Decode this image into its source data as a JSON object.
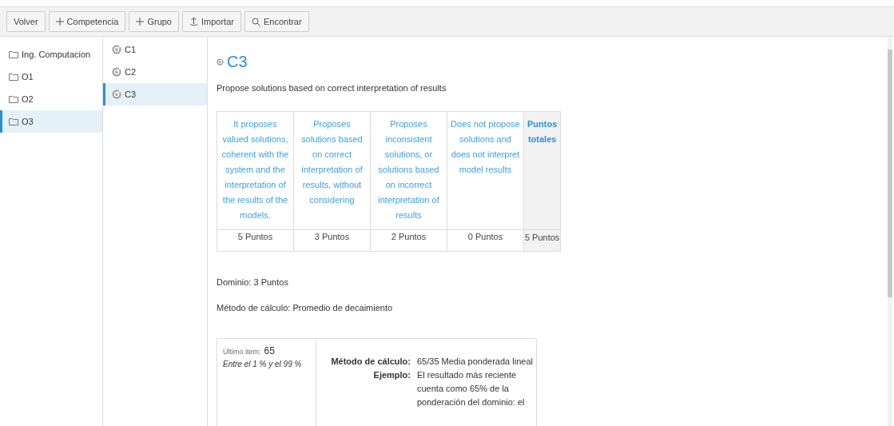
{
  "toolbar": [
    {
      "kind": "plain",
      "label": "Volver"
    },
    {
      "kind": "add",
      "label": "Competencia"
    },
    {
      "kind": "add",
      "label": "Grupo"
    },
    {
      "kind": "import",
      "label": "Importar"
    },
    {
      "kind": "search",
      "label": "Encontrar"
    }
  ],
  "groups": [
    {
      "label": "Ing. Computacion",
      "selected": false
    },
    {
      "label": "O1",
      "selected": false
    },
    {
      "label": "O2",
      "selected": false
    },
    {
      "label": "O3",
      "selected": true
    }
  ],
  "competencies": [
    {
      "label": "C1",
      "selected": false
    },
    {
      "label": "C2",
      "selected": false
    },
    {
      "label": "C3",
      "selected": true
    }
  ],
  "detail": {
    "title": "C3",
    "description": "Propose solutions based on correct interpretation of results",
    "rubric": {
      "criteria": [
        {
          "description": "It proposes valued solutions, coherent with the system and the interpretation of the results of the models.",
          "points": "5 Puntos"
        },
        {
          "description": "Proposes solutions based on correct interpretation of results, without considering",
          "points": "3 Puntos"
        },
        {
          "description": "Proposes inconsistent solutions, or solutions based on incorrect interpretation of results",
          "points": "2 Puntos"
        },
        {
          "description": "Does not propose solutions and does not interpret model results",
          "points": "0 Puntos"
        }
      ],
      "total_heading": "Puntos totales",
      "total": "5 Puntos"
    },
    "mastery": "Dominio: 3 Puntos",
    "method": "Método de cálculo: Promedio de decaimiento",
    "calc_box": {
      "last_item_label": "Último item:",
      "last_item_value": "65",
      "range": "Entre el 1 % y el 99 %",
      "rows": [
        {
          "label": "Método de cálculo:",
          "value": "65/35 Media ponderada lineal"
        },
        {
          "label": "Ejemplo:",
          "value": "El resultado más reciente cuenta como 65% de la ponderación del dominio: el"
        }
      ]
    }
  }
}
